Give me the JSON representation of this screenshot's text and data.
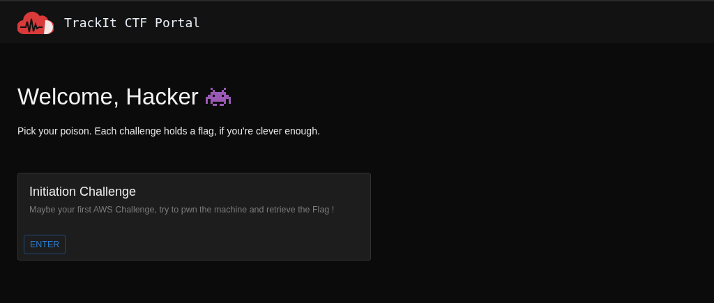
{
  "header": {
    "title": "TrackIt CTF Portal"
  },
  "welcome": {
    "heading": "Welcome, Hacker",
    "subtitle": "Pick your poison. Each challenge holds a flag, if you're clever enough."
  },
  "challenges": [
    {
      "title": "Initiation Challenge",
      "description": "Maybe your first AWS Challenge, try to pwn the machine and retrieve the Flag !",
      "button": "ENTER"
    }
  ]
}
